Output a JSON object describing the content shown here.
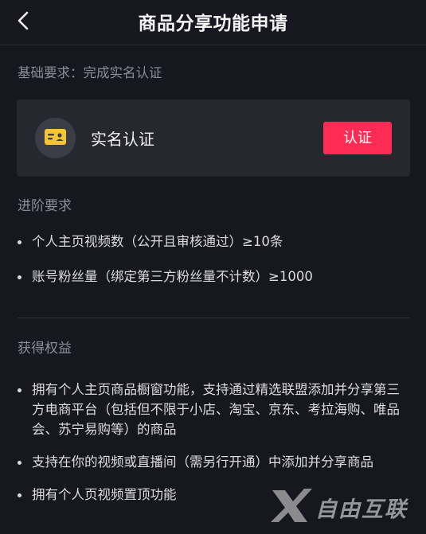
{
  "header": {
    "title": "商品分享功能申请"
  },
  "basic": {
    "requirement_text": "基础要求：完成实名认证"
  },
  "verify_card": {
    "label": "实名认证",
    "button_label": "认证",
    "icon": "id-card-icon"
  },
  "advanced": {
    "heading": "进阶要求",
    "items": [
      "个人主页视频数（公开且审核通过）≥10条",
      "账号粉丝量（绑定第三方粉丝量不计数）≥1000"
    ]
  },
  "benefits": {
    "heading": "获得权益",
    "items": [
      "拥有个人主页商品橱窗功能，支持通过精选联盟添加并分享第三方电商平台（包括但不限于小店、淘宝、京东、考拉海购、唯品会、苏宁易购等）的商品",
      "支持在你的视频或直播间（需另行开通）中添加并分享商品",
      "拥有个人页视频置顶功能"
    ]
  },
  "watermark": {
    "text": "自由互联"
  },
  "colors": {
    "background": "#16171f",
    "card": "#26272f",
    "accent": "#fe2c55",
    "icon_yellow": "#f7c531"
  }
}
